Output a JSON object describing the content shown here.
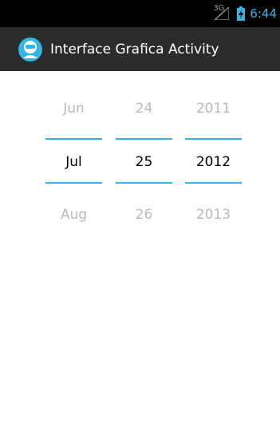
{
  "status_bar": {
    "network": "3G",
    "time": "6:44",
    "signal_icon": "signal-icon",
    "battery_icon": "battery-charging-icon"
  },
  "action_bar": {
    "title": "Interface Grafica Activity",
    "app_icon": "app-avatar-icon"
  },
  "date_picker": {
    "month": {
      "prev": "Jun",
      "current": "Jul",
      "next": "Aug"
    },
    "day": {
      "prev": "24",
      "current": "25",
      "next": "26"
    },
    "year": {
      "prev": "2011",
      "current": "2012",
      "next": "2013"
    }
  },
  "colors": {
    "accent": "#33b5e5",
    "action_bar_bg": "#2b2b2b",
    "status_bar_bg": "#000000"
  }
}
